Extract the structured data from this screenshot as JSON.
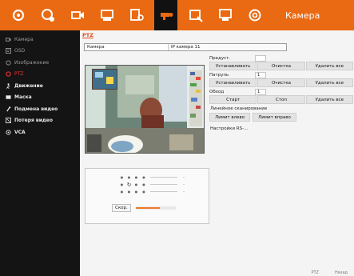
{
  "toolbar": {
    "title": "Камера",
    "buttons": [
      {
        "icon": "gear-icon",
        "active": false
      },
      {
        "icon": "network-icon",
        "active": false
      },
      {
        "icon": "camera-icon",
        "active": false
      },
      {
        "icon": "record-icon",
        "active": false
      },
      {
        "icon": "alarm-icon",
        "active": false
      },
      {
        "icon": "ptz-icon",
        "active": true
      },
      {
        "icon": "exception-icon",
        "active": false
      },
      {
        "icon": "storage-icon",
        "active": false
      },
      {
        "icon": "power-icon",
        "active": false
      }
    ]
  },
  "sidebar": {
    "items": [
      {
        "label": "Камера",
        "icon": "camera-icon",
        "state": "normal"
      },
      {
        "label": "OSD",
        "icon": "osd-icon",
        "state": "normal"
      },
      {
        "label": "Изображение",
        "icon": "image-icon",
        "state": "normal"
      },
      {
        "label": "PTZ",
        "icon": "ptz-icon",
        "state": "active"
      },
      {
        "label": "Движение",
        "icon": "motion-icon",
        "state": "bold"
      },
      {
        "label": "Маска",
        "icon": "mask-icon",
        "state": "bold"
      },
      {
        "label": "Подмена видео",
        "icon": "tamper-icon",
        "state": "bold"
      },
      {
        "label": "Потеря видео",
        "icon": "video-loss-icon",
        "state": "bold"
      },
      {
        "label": "VCA",
        "icon": "vca-icon",
        "state": "bold"
      }
    ]
  },
  "main": {
    "section_title": "PTZ",
    "camera_label": "Камера",
    "camera_value": "IP камера 11",
    "speed_label": "Скор.",
    "speed_level": 0.6,
    "preset": {
      "label": "Предуст.",
      "value": "",
      "set": "Устанавливать",
      "clear": "Очистка",
      "delete_all": "Удалить все"
    },
    "patrol": {
      "label": "Патруль",
      "value": "1",
      "set": "Устанавливать",
      "clear": "Очистка",
      "delete_all": "Удалить все"
    },
    "pattern": {
      "label": "Обход",
      "value": "1",
      "start": "Старт",
      "stop": "Стоп",
      "delete_all": "Удалить все"
    },
    "linear_scan": {
      "label": "Линейное сканирование",
      "left_limit": "Лимит влево",
      "right_limit": "Лимит вправо"
    },
    "rs_settings": "Настройки RS-..."
  },
  "footer": {
    "left": "PTZ",
    "right": "Назад"
  },
  "colors": {
    "accent": "#e96a13",
    "active_text": "#ff2f2f",
    "title_text": "#e34b1b"
  }
}
